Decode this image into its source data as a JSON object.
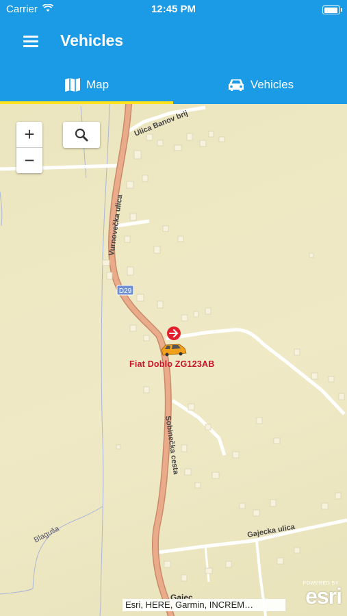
{
  "status_bar": {
    "carrier": "Carrier",
    "time": "12:45 PM",
    "battery_level": 1.0
  },
  "nav": {
    "title": "Vehicles"
  },
  "tabs": [
    {
      "label": "Map",
      "icon": "map-icon",
      "active": true
    },
    {
      "label": "Vehicles",
      "icon": "car-icon",
      "active": false
    }
  ],
  "map": {
    "zoom_in": "+",
    "zoom_out": "−",
    "vehicle": {
      "label": "Fiat Doblo ZG123AB"
    },
    "street_labels": [
      "Ulica Banov brij",
      "Vurnovečka ulica",
      "D29",
      "Sobinečka cesta",
      "Blaguša",
      "Gajecka ulica",
      "Gajec"
    ],
    "attribution": "Esri, HERE, Garmin, INCREM…",
    "logo": {
      "powered": "POWERED BY",
      "brand": "esri"
    }
  },
  "colors": {
    "header": "#1b9be6",
    "tab_indicator": "#ffe21f",
    "map_background": "#eee9c4",
    "road_main": "#e8a785",
    "vehicle_label": "#c8142b"
  }
}
